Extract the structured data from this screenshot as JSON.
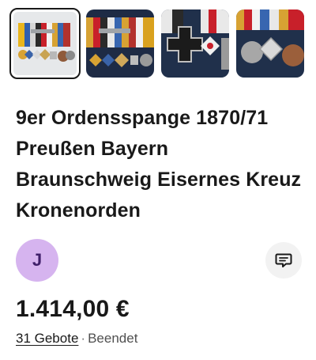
{
  "gallery": {
    "thumbnails": [
      {
        "label": "medal-bar-front-photo",
        "selected": true
      },
      {
        "label": "medal-bar-angled-photo",
        "selected": false
      },
      {
        "label": "iron-cross-closeup-photo",
        "selected": false
      },
      {
        "label": "medals-detail-photo",
        "selected": false
      }
    ]
  },
  "listing": {
    "title": "9er Ordensspange 1870/71 Preußen Bayern Braunschweig Eisernes Kreuz Kronenorden",
    "price": "1.414,00 €",
    "bids": "31 Gebote",
    "separator": "·",
    "status": "Beendet"
  },
  "seller": {
    "avatar_initial": "J",
    "avatar_color": "#d6b4ef"
  },
  "icons": {
    "message": "chat-bubble-icon"
  }
}
